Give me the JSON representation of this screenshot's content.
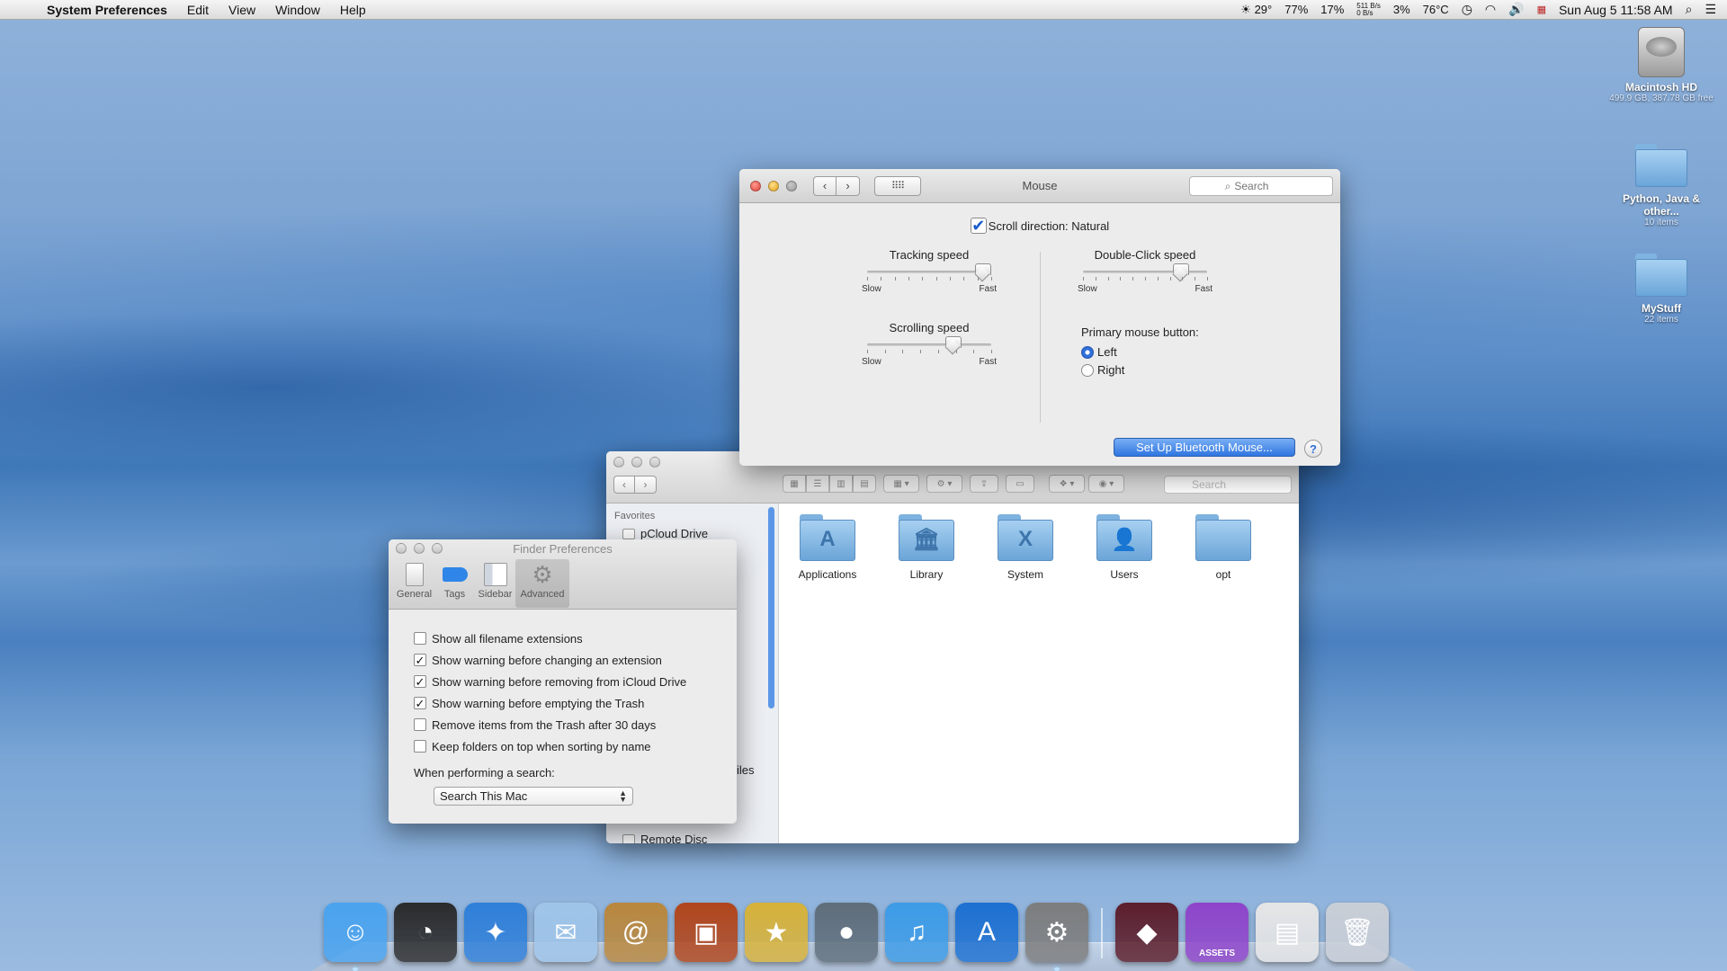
{
  "menubar": {
    "apple": "",
    "app_name": "System Preferences",
    "menus": [
      "Edit",
      "View",
      "Window",
      "Help"
    ],
    "status": {
      "weather": "☀ 29°",
      "battery_pct": "77%",
      "cpu": "17%",
      "net_up": "511 B/s",
      "net_down": "0 B/s",
      "disk": "3%",
      "temp": "76°C",
      "clock": "Sun Aug 5  11:58 AM"
    }
  },
  "desktop": {
    "items": [
      {
        "label": "Macintosh HD",
        "sub": "499.9 GB, 387.78 GB free"
      },
      {
        "label": "Python, Java & other...",
        "sub": "10 items"
      },
      {
        "label": "MyStuff",
        "sub": "22 items"
      }
    ]
  },
  "mouse_window": {
    "title": "Mouse",
    "search_placeholder": "Search",
    "scroll_direction_label": "Scroll direction: Natural",
    "scroll_direction_checked": true,
    "tracking": {
      "title": "Tracking speed",
      "slow": "Slow",
      "fast": "Fast",
      "level": 0.93
    },
    "scrolling": {
      "title": "Scrolling speed",
      "slow": "Slow",
      "fast": "Fast",
      "level": 0.69
    },
    "double_click": {
      "title": "Double-Click speed",
      "slow": "Slow",
      "fast": "Fast",
      "level": 0.78
    },
    "primary_button_label": "Primary mouse button:",
    "primary_options": [
      {
        "label": "Left",
        "selected": true
      },
      {
        "label": "Right",
        "selected": false
      }
    ],
    "bluetooth_button": "Set Up Bluetooth Mouse...",
    "help": "?"
  },
  "finder_window": {
    "search_placeholder": "Search",
    "sidebar": {
      "section": "Favorites",
      "items": [
        "pCloud Drive"
      ],
      "partial": "iles",
      "bottom_item": "Remote Disc"
    },
    "items": [
      {
        "name": "Applications",
        "symbol": "A"
      },
      {
        "name": "Library",
        "symbol": "🏛"
      },
      {
        "name": "System",
        "symbol": "X"
      },
      {
        "name": "Users",
        "symbol": "👤"
      },
      {
        "name": "opt",
        "symbol": ""
      }
    ]
  },
  "finder_prefs": {
    "title": "Finder Preferences",
    "tabs": [
      "General",
      "Tags",
      "Sidebar",
      "Advanced"
    ],
    "selected_tab": "Advanced",
    "options": [
      {
        "label": "Show all filename extensions",
        "checked": false
      },
      {
        "label": "Show warning before changing an extension",
        "checked": true
      },
      {
        "label": "Show warning before removing from iCloud Drive",
        "checked": true
      },
      {
        "label": "Show warning before emptying the Trash",
        "checked": true
      },
      {
        "label": "Remove items from the Trash after 30 days",
        "checked": false
      },
      {
        "label": "Keep folders on top when sorting by name",
        "checked": false
      }
    ],
    "search_label": "When performing a search:",
    "search_value": "Search This Mac"
  },
  "dock": {
    "items": [
      {
        "name": "finder",
        "color": "#4aa3ee",
        "glyph": "☺",
        "running": true
      },
      {
        "name": "dashboard",
        "color": "#2b2b2b",
        "glyph": "◔",
        "running": false
      },
      {
        "name": "safari",
        "color": "#2f7fd8",
        "glyph": "✦",
        "running": false
      },
      {
        "name": "mail",
        "color": "#9fc4e8",
        "glyph": "✉",
        "running": false
      },
      {
        "name": "contacts",
        "color": "#b9873d",
        "glyph": "@",
        "running": false
      },
      {
        "name": "photo-booth",
        "color": "#b1451b",
        "glyph": "▣",
        "running": false
      },
      {
        "name": "imovie",
        "color": "#d7b23a",
        "glyph": "★",
        "running": false
      },
      {
        "name": "facetime",
        "color": "#5f6d7a",
        "glyph": "●",
        "running": false
      },
      {
        "name": "itunes",
        "color": "#3d9be6",
        "glyph": "♫",
        "running": false
      },
      {
        "name": "app-store",
        "color": "#1d70d1",
        "glyph": "A",
        "running": false
      },
      {
        "name": "system-preferences",
        "color": "#7d7d7d",
        "glyph": "⚙",
        "running": true
      }
    ],
    "right_items": [
      {
        "name": "downloads-stack",
        "color": "#5c1e2c",
        "glyph": "◆"
      },
      {
        "name": "assets-stack",
        "color": "#8e44c9",
        "glyph": "ASSETS"
      },
      {
        "name": "documents-stack",
        "color": "#e5e5e5",
        "glyph": "▤"
      },
      {
        "name": "trash",
        "color": "#c9ced6",
        "glyph": "🗑"
      }
    ]
  }
}
